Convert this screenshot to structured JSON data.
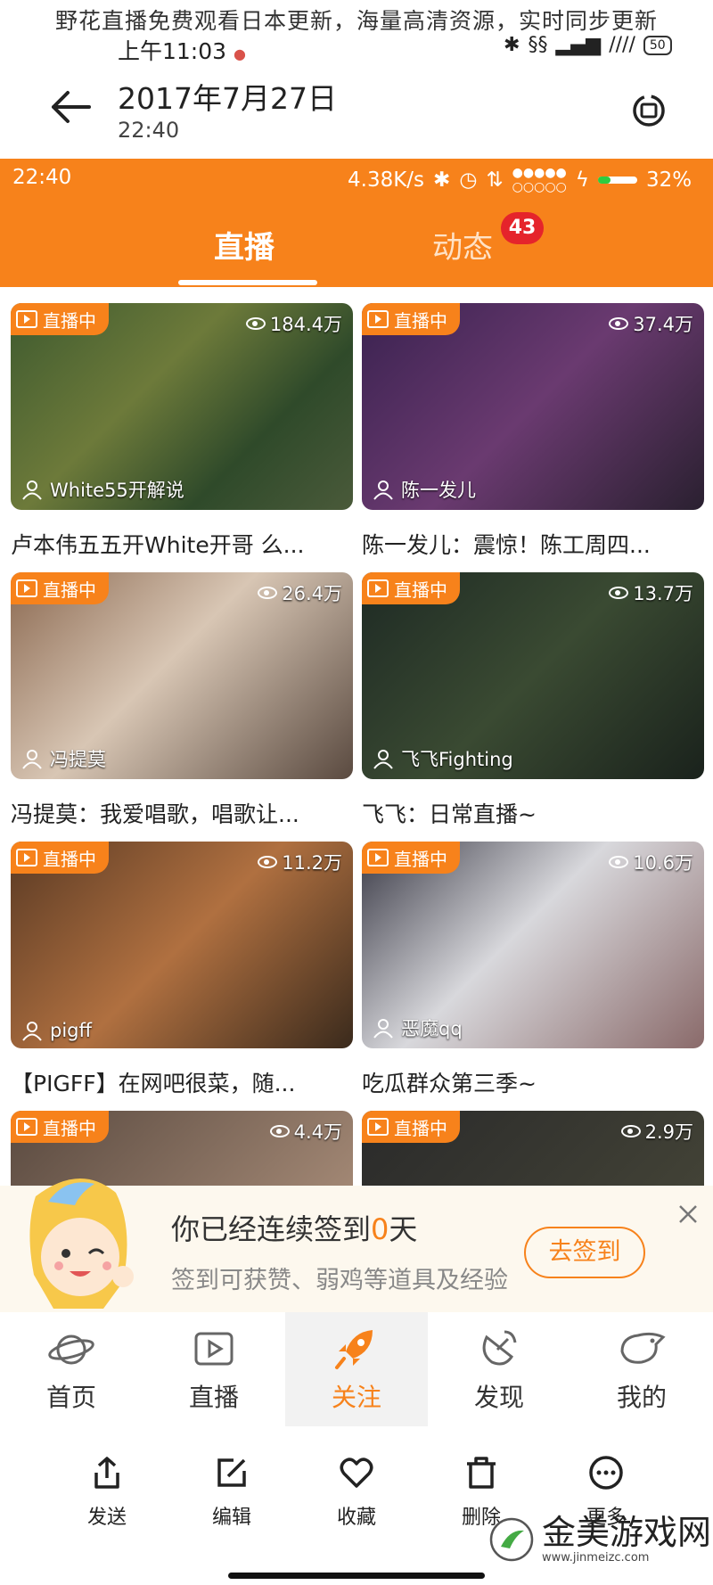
{
  "caption": "野花直播免费观看日本更新，海量高清资源，实时同步更新",
  "os_status": {
    "time": "上午11:03",
    "battery": "50"
  },
  "header": {
    "date": "2017年7月27日",
    "time": "22:40"
  },
  "inner_status": {
    "time": "22:40",
    "speed": "4.38K/s",
    "battery": "32%"
  },
  "tabs": [
    {
      "label": "直播"
    },
    {
      "label": "动态",
      "badge": "43"
    }
  ],
  "live_label": "直播中",
  "streams": [
    {
      "views": "184.4万",
      "streamer": "White55开解说",
      "title": "卢本伟五五开White开哥 么..."
    },
    {
      "views": "37.4万",
      "streamer": "陈一发儿",
      "title": "陈一发儿：震惊！陈工周四..."
    },
    {
      "views": "26.4万",
      "streamer": "冯提莫",
      "title": "冯提莫：我爱唱歌，唱歌让..."
    },
    {
      "views": "13.7万",
      "streamer": "飞飞Fighting",
      "title": "飞飞：日常直播~"
    },
    {
      "views": "11.2万",
      "streamer": "pigff",
      "title": "【PIGFF】在网吧很菜，随..."
    },
    {
      "views": "10.6万",
      "streamer": "恶魔qq",
      "title": "吃瓜群众第三季~"
    },
    {
      "views": "4.4万"
    },
    {
      "views": "2.9万"
    }
  ],
  "signin": {
    "prefix": "你已经连续签到",
    "days": "0",
    "suffix": "天",
    "sub": "签到可获赞、弱鸡等道具及经验",
    "button": "去签到"
  },
  "nav": [
    {
      "label": "首页",
      "icon": "planet-icon"
    },
    {
      "label": "直播",
      "icon": "tv-play-icon"
    },
    {
      "label": "关注",
      "icon": "rocket-icon"
    },
    {
      "label": "发现",
      "icon": "satellite-dish-icon"
    },
    {
      "label": "我的",
      "icon": "chicken-icon"
    }
  ],
  "sheet": [
    {
      "label": "发送",
      "icon": "share-icon"
    },
    {
      "label": "编辑",
      "icon": "edit-icon"
    },
    {
      "label": "收藏",
      "icon": "heart-icon"
    },
    {
      "label": "删除",
      "icon": "trash-icon"
    },
    {
      "label": "更多",
      "icon": "more-icon"
    }
  ],
  "watermark": {
    "name": "金美游戏网",
    "url": "www.jinmeizc.com"
  },
  "colors": {
    "accent": "#f7821b",
    "badge": "#e5242b"
  }
}
